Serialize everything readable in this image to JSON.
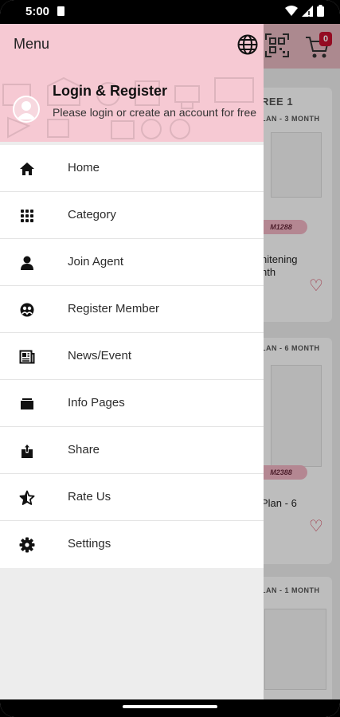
{
  "status_bar": {
    "time": "5:00"
  },
  "drawer": {
    "title": "Menu",
    "login": {
      "title": "Login & Register",
      "subtitle": "Please login or create an account for free"
    },
    "items": [
      {
        "label": "Home",
        "icon": "home-icon"
      },
      {
        "label": "Category",
        "icon": "grid-icon"
      },
      {
        "label": "Join Agent",
        "icon": "person-icon"
      },
      {
        "label": "Register Member",
        "icon": "member-icon"
      },
      {
        "label": "News/Event",
        "icon": "newspaper-icon"
      },
      {
        "label": "Info Pages",
        "icon": "folder-icon"
      },
      {
        "label": "Share",
        "icon": "share-icon"
      },
      {
        "label": "Rate Us",
        "icon": "star-icon"
      },
      {
        "label": "Settings",
        "icon": "gear-icon"
      }
    ]
  },
  "background": {
    "cart_badge": "0",
    "cards": [
      {
        "plan": "REE 1",
        "plan2": "LAN - 3 MONTH",
        "price": "M1288",
        "name": "hitening\nnth"
      },
      {
        "plan": "LAN - 6 MONTH",
        "price": "M2388",
        "name": "Plan - 6"
      },
      {
        "plan": "LAN - 1 MONTH"
      }
    ]
  },
  "colors": {
    "header_pink": "#f6c9d3",
    "heart": "#d4405a",
    "badge": "#c8102e"
  }
}
